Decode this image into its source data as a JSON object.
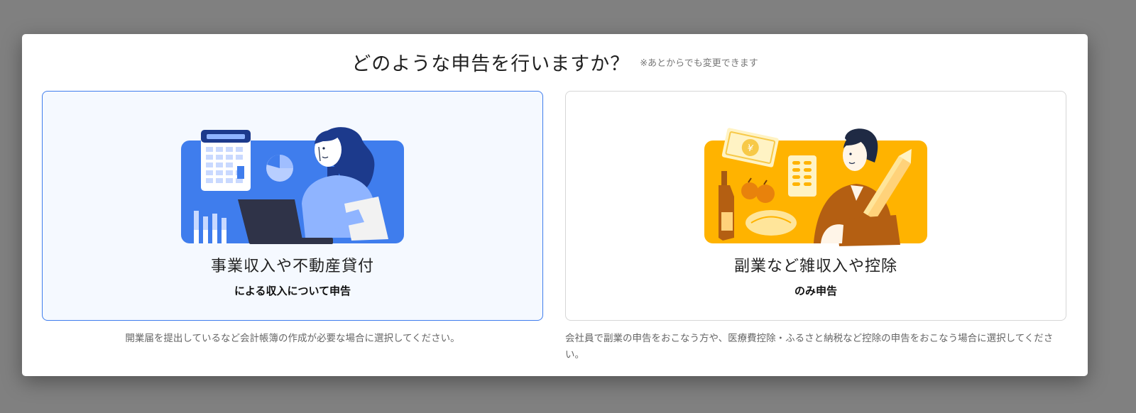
{
  "dialog": {
    "title": "どのような申告を行いますか？",
    "note": "※あとからでも変更できます"
  },
  "options": [
    {
      "title": "事業収入や不動産貸付",
      "subtitle": "による収入について申告",
      "description": "開業届を提出しているなど会計帳簿の作成が必要な場合に選択してください。",
      "selected": true,
      "illustration": "business-income-illustration",
      "accent_color": "#3f7ded"
    },
    {
      "title": "副業など雑収入や控除",
      "subtitle": "のみ申告",
      "description": "会社員で副業の申告をおこなう方や、医療費控除・ふるさと納税など控除の申告をおこなう場合に選択してください。",
      "selected": false,
      "illustration": "side-income-illustration",
      "accent_color": "#ffb300"
    }
  ],
  "illustration_text": {
    "yen_symbol": "¥"
  },
  "colors": {
    "overlay": "#808080",
    "selected_border": "#3f7ded",
    "selected_background": "#f5f9ff",
    "blue_panel": "#3f7ded",
    "orange_panel": "#ffb300"
  }
}
